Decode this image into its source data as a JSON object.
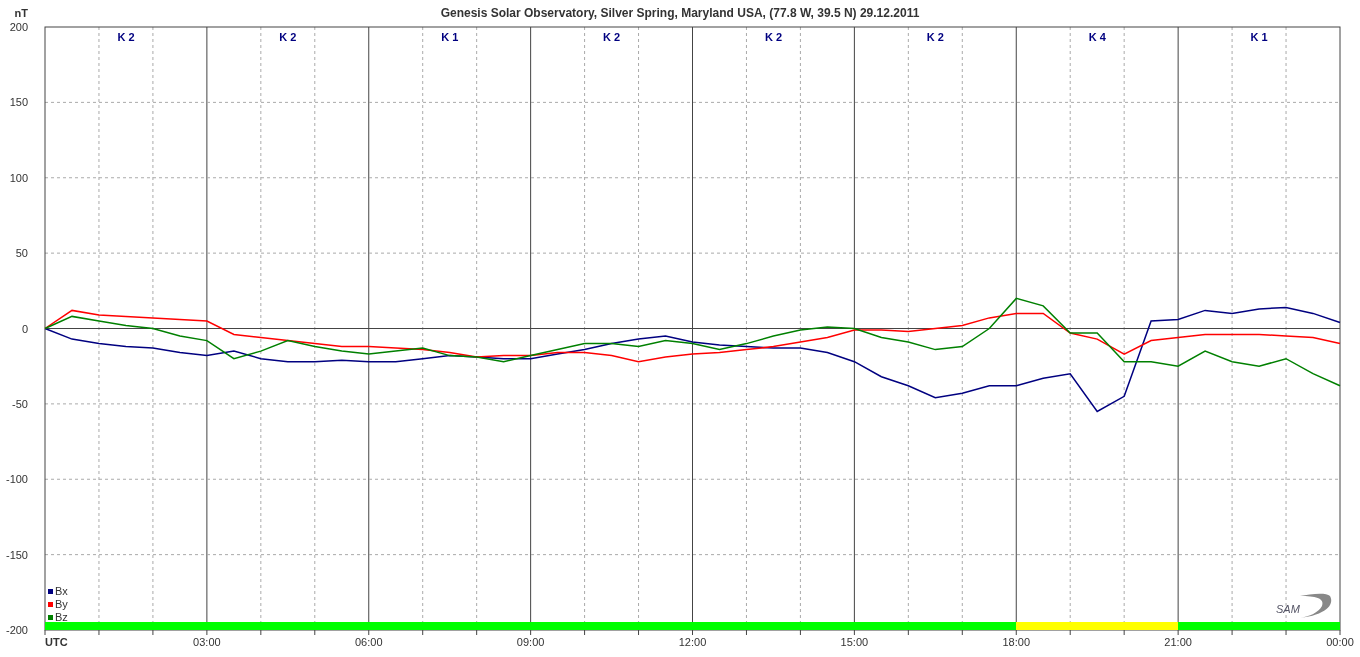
{
  "chart_data": {
    "type": "line",
    "title": "Genesis Solar Observatory, Silver Spring, Maryland USA, (77.8 W, 39.5 N)  29.12.2011",
    "xlabel": "UTC",
    "ylabel": "nT",
    "x": [
      0,
      0.5,
      1,
      1.5,
      2,
      2.5,
      3,
      3.5,
      4,
      4.5,
      5,
      5.5,
      6,
      6.5,
      7,
      7.5,
      8,
      8.5,
      9,
      9.5,
      10,
      10.5,
      11,
      11.5,
      12,
      12.5,
      13,
      13.5,
      14,
      14.5,
      15,
      15.5,
      16,
      16.5,
      17,
      17.5,
      18,
      18.5,
      19,
      19.5,
      20,
      20.5,
      21,
      21.5,
      22,
      22.5,
      23,
      23.5,
      24
    ],
    "series": [
      {
        "name": "Bx",
        "color": "#000080",
        "values": [
          0,
          -7,
          -10,
          -12,
          -13,
          -16,
          -18,
          -15,
          -20,
          -22,
          -22,
          -21,
          -22,
          -22,
          -20,
          -18,
          -19,
          -20,
          -20,
          -17,
          -14,
          -10,
          -7,
          -5,
          -9,
          -11,
          -12,
          -13,
          -13,
          -16,
          -22,
          -32,
          -38,
          -46,
          -43,
          -38,
          -38,
          -33,
          -30,
          -55,
          -45,
          5,
          6,
          12,
          10,
          13,
          14,
          10,
          4
        ]
      },
      {
        "name": "By",
        "color": "#ff0000",
        "values": [
          0,
          12,
          9,
          8,
          7,
          6,
          5,
          -4,
          -6,
          -8,
          -10,
          -12,
          -12,
          -13,
          -14,
          -16,
          -19,
          -18,
          -18,
          -16,
          -16,
          -18,
          -22,
          -19,
          -17,
          -16,
          -14,
          -12,
          -9,
          -6,
          -1,
          -1,
          -2,
          0,
          2,
          7,
          10,
          10,
          -3,
          -7,
          -17,
          -8,
          -6,
          -4,
          -4,
          -4,
          -5,
          -6,
          -10
        ]
      },
      {
        "name": "Bz",
        "color": "#008000",
        "values": [
          0,
          8,
          5,
          2,
          0,
          -5,
          -8,
          -20,
          -15,
          -8,
          -12,
          -15,
          -17,
          -15,
          -13,
          -18,
          -19,
          -22,
          -18,
          -14,
          -10,
          -10,
          -12,
          -8,
          -10,
          -14,
          -10,
          -5,
          -1,
          1,
          0,
          -6,
          -9,
          -14,
          -12,
          0,
          20,
          15,
          -3,
          -3,
          -22,
          -22,
          -25,
          -15,
          -22,
          -25,
          -20,
          -30,
          -38
        ]
      }
    ],
    "xlim": [
      0,
      24
    ],
    "ylim": [
      -200,
      200
    ],
    "grid": true,
    "legend": "lower left",
    "xticks": [
      {
        "value": 3,
        "label": "03:00"
      },
      {
        "value": 6,
        "label": "06:00"
      },
      {
        "value": 9,
        "label": "09:00"
      },
      {
        "value": 12,
        "label": "12:00"
      },
      {
        "value": 15,
        "label": "15:00"
      },
      {
        "value": 18,
        "label": "18:00"
      },
      {
        "value": 21,
        "label": "21:00"
      },
      {
        "value": 24,
        "label": "00:00"
      }
    ],
    "yticks": [
      -200,
      -150,
      -100,
      -50,
      0,
      50,
      100,
      150,
      200
    ]
  },
  "k_indices": [
    {
      "label": "K 2",
      "color": "#00ff00"
    },
    {
      "label": "K 2",
      "color": "#00ff00"
    },
    {
      "label": "K 1",
      "color": "#00ff00"
    },
    {
      "label": "K 2",
      "color": "#00ff00"
    },
    {
      "label": "K 2",
      "color": "#00ff00"
    },
    {
      "label": "K 2",
      "color": "#00ff00"
    },
    {
      "label": "K 4",
      "color": "#ffff00"
    },
    {
      "label": "K 1",
      "color": "#00ff00"
    }
  ],
  "logo": "SAM"
}
